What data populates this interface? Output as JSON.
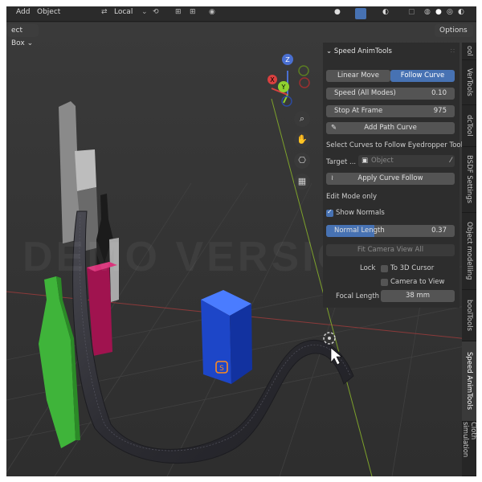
{
  "topbar": {
    "menu_add": "Add",
    "menu_object": "Object",
    "orientation": "Local"
  },
  "header": {
    "editor_mode": "ect Box",
    "options_label": "Options"
  },
  "watermark": "DEMO VERSION",
  "gizmo": {
    "z": "Z",
    "x": "X",
    "y": "Y"
  },
  "panel": {
    "title": "Speed AnimTools",
    "tab_linear": "Linear Move",
    "tab_follow": "Follow Curve",
    "speed_label": "Speed (All Modes)",
    "speed_value": "0.10",
    "stop_label": "Stop At Frame",
    "stop_value": "975",
    "add_path_label": "Add Path Curve",
    "select_curves_text": "Select Curves to Follow Eyedropper Tool",
    "target_label": "Target ...",
    "target_placeholder": "Object",
    "apply_label": "Apply Curve Follow",
    "edit_mode_text": "Edit Mode only",
    "show_normals_label": "Show Normals",
    "normal_length_label": "Normal Length",
    "normal_length_value": "0.37",
    "fit_camera_label": "Fit Camera View All",
    "lock_label": "Lock",
    "to_cursor_label": "To 3D Cursor",
    "camera_to_view_label": "Camera to View",
    "focal_label": "Focal Length",
    "focal_value": "38 mm"
  },
  "tabs": [
    "ool",
    "VerTools",
    "dcTool",
    "BSDF Settings",
    "Object modelling",
    "boolTools",
    "Speed AnimTools",
    "Cloth simulation"
  ],
  "colors": {
    "accent_blue": "#4772b3",
    "green_object": "#3fb43a",
    "magenta_object": "#a0134f",
    "blue_cube": "#1d46c8",
    "curve_tube": "#3a3a40"
  }
}
